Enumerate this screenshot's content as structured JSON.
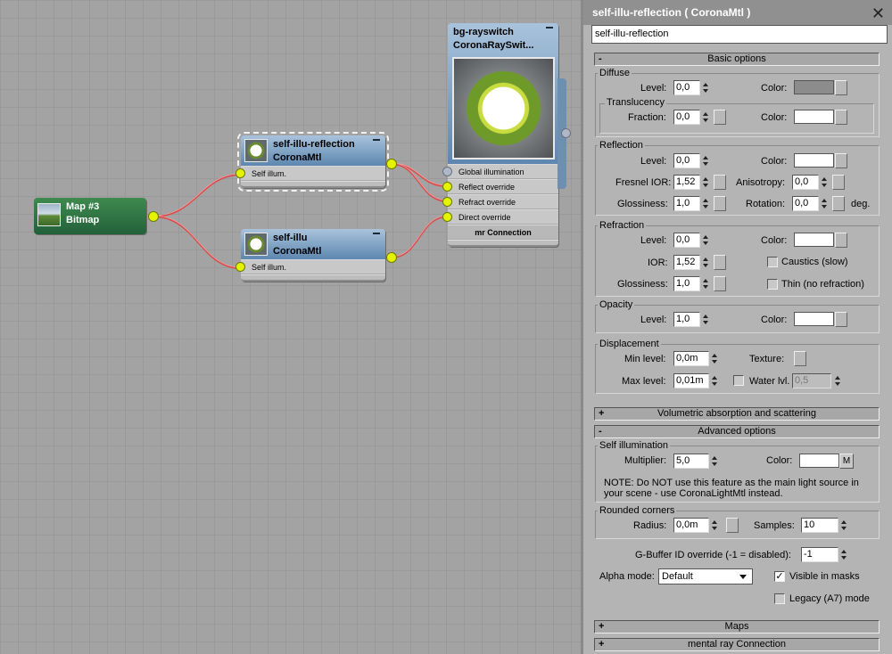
{
  "graph": {
    "nodes": {
      "bitmap": {
        "title": "Map #3",
        "subtitle": "Bitmap"
      },
      "reflection": {
        "title": "self-illu-reflection",
        "subtitle": "CoronaMtl",
        "slot": "Self illum."
      },
      "selfillu": {
        "title": "self-illu",
        "subtitle": "CoronaMtl",
        "slot": "Self illum."
      },
      "rayswitch": {
        "title": "bg-rayswitch",
        "subtitle": "CoronaRaySwit...",
        "slots": [
          "Global illumination",
          "Reflect override",
          "Refract override",
          "Direct override"
        ],
        "footer": "mr Connection"
      }
    }
  },
  "panel": {
    "title": "self-illu-reflection  ( CoronaMtl )",
    "close": "✕",
    "name_value": "self-illu-reflection",
    "rollouts": {
      "basic": {
        "sign": "-",
        "label": "Basic options"
      },
      "volumetric": {
        "sign": "+",
        "label": "Volumetric absorption and scattering"
      },
      "advanced": {
        "sign": "-",
        "label": "Advanced options"
      },
      "maps": {
        "sign": "+",
        "label": "Maps"
      },
      "mr": {
        "sign": "+",
        "label": "mental ray Connection"
      }
    },
    "diffuse": {
      "group": "Diffuse",
      "level_label": "Level:",
      "level": "0,0",
      "color_label": "Color:",
      "translucency": "Translucency",
      "fraction_label": "Fraction:",
      "fraction": "0,0",
      "tcolor_label": "Color:"
    },
    "reflection": {
      "group": "Reflection",
      "level_label": "Level:",
      "level": "0,0",
      "color_label": "Color:",
      "fresnel_label": "Fresnel IOR:",
      "fresnel": "1,52",
      "aniso_label": "Anisotropy:",
      "aniso": "0,0",
      "gloss_label": "Glossiness:",
      "gloss": "1,0",
      "rot_label": "Rotation:",
      "rot": "0,0",
      "deg": "deg."
    },
    "refraction": {
      "group": "Refraction",
      "level_label": "Level:",
      "level": "0,0",
      "color_label": "Color:",
      "ior_label": "IOR:",
      "ior": "1,52",
      "caustics": "Caustics (slow)",
      "gloss_label": "Glossiness:",
      "gloss": "1,0",
      "thin": "Thin (no refraction)"
    },
    "opacity": {
      "group": "Opacity",
      "level_label": "Level:",
      "level": "1,0",
      "color_label": "Color:"
    },
    "displacement": {
      "group": "Displacement",
      "min_label": "Min level:",
      "min": "0,0m",
      "texture_label": "Texture:",
      "max_label": "Max level:",
      "max": "0,01m",
      "water_label": "Water lvl.",
      "water": "0,5"
    },
    "selfillum": {
      "group": "Self illumination",
      "mult_label": "Multiplier:",
      "mult": "5,0",
      "color_label": "Color:",
      "m_btn": "M",
      "note1": "NOTE: Do NOT use this feature as the main light source in",
      "note2": "your scene - use CoronaLightMtl instead."
    },
    "rounded": {
      "group": "Rounded corners",
      "radius_label": "Radius:",
      "radius": "0,0m",
      "samples_label": "Samples:",
      "samples": "10"
    },
    "gbuffer": {
      "label": "G-Buffer ID override (-1 = disabled):",
      "value": "-1"
    },
    "alpha": {
      "label": "Alpha mode:",
      "value": "Default"
    },
    "visible_masks": "Visible in masks",
    "legacy": "Legacy (A7) mode"
  },
  "colors": {
    "diffuse": "#8c8c8c",
    "white": "#ffffff",
    "node_blue": "#5d87b0",
    "node_green": "#23603a",
    "wire": "#d84a4a",
    "socket": "#e4f400"
  }
}
